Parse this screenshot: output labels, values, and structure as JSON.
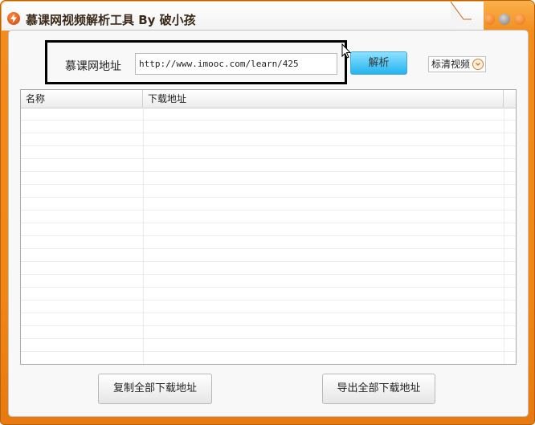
{
  "window": {
    "title": "慕课网视频解析工具 By 破小孩",
    "brand_color": "#f28c1c",
    "controls": [
      {
        "name": "minimize-button",
        "color": "#f07a14"
      },
      {
        "name": "restore-button",
        "color": "#8e8e8e"
      },
      {
        "name": "close-button",
        "color": "#f07a14"
      }
    ]
  },
  "form": {
    "url_label": "慕课网地址",
    "url_value": "http://www.imooc.com/learn/425",
    "parse_label": "解析",
    "quality": "标清视频"
  },
  "table": {
    "columns": [
      "名称",
      "下载地址"
    ],
    "rows": []
  },
  "actions": {
    "copy_all": "复制全部下载地址",
    "export_all": "导出全部下载地址"
  }
}
